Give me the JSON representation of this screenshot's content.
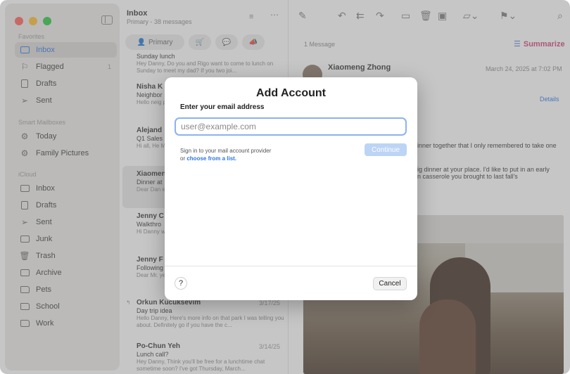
{
  "sidebar": {
    "favorites_header": "Favorites",
    "smart_header": "Smart Mailboxes",
    "icloud_header": "iCloud",
    "favorites": [
      {
        "label": "Inbox",
        "icon": "tray-icon"
      },
      {
        "label": "Flagged",
        "icon": "flag-icon",
        "count": "1"
      },
      {
        "label": "Drafts",
        "icon": "document-icon"
      },
      {
        "label": "Sent",
        "icon": "paperplane-icon"
      }
    ],
    "smart": [
      {
        "label": "Today",
        "icon": "gear-icon"
      },
      {
        "label": "Family Pictures",
        "icon": "gear-icon"
      }
    ],
    "icloud": [
      {
        "label": "Inbox",
        "icon": "tray-icon"
      },
      {
        "label": "Drafts",
        "icon": "document-icon"
      },
      {
        "label": "Sent",
        "icon": "paperplane-icon"
      },
      {
        "label": "Junk",
        "icon": "junk-icon"
      },
      {
        "label": "Trash",
        "icon": "trash-icon"
      },
      {
        "label": "Archive",
        "icon": "archive-icon"
      },
      {
        "label": "Pets",
        "icon": "folder-icon"
      },
      {
        "label": "School",
        "icon": "folder-icon"
      },
      {
        "label": "Work",
        "icon": "folder-icon"
      }
    ]
  },
  "message_list": {
    "title": "Inbox",
    "subtitle": "Primary - 38 messages",
    "primary_tab": "Primary",
    "messages": [
      {
        "from": "",
        "date": "",
        "subject": "Sunday lunch",
        "preview": "Hey Danny, Do you and Rigo want to come to lunch on Sunday to meet my dad? If you two joi..."
      },
      {
        "from": "Nisha K",
        "date": "",
        "subject": "Neighbor",
        "preview": "Hello neig planning"
      },
      {
        "from": "Alejand",
        "date": "",
        "subject": "Q1 Sales",
        "preview": "Hi all, He Mark IV a"
      },
      {
        "from": "Xiaomen",
        "date": "",
        "subject": "Dinner at",
        "preview": "Dear Dan evening."
      },
      {
        "from": "Jenny C",
        "date": "",
        "subject": "Walkthro",
        "preview": "Hi Danny walkthro"
      },
      {
        "from": "Jenny F",
        "date": "",
        "subject": "Following",
        "preview": "Dear Mr. yesterday"
      },
      {
        "from": "Orkun Kucuksevim",
        "date": "3/17/25",
        "subject": "Day trip idea",
        "preview": "Hello Danny, Here's more info on that park I was telling you about. Definitely go if you have the c..."
      },
      {
        "from": "Po-Chun Yeh",
        "date": "3/14/25",
        "subject": "Lunch call?",
        "preview": "Hey Danny, Think you'll be free for a lunchtime chat sometime soon? I've got Thursday, March..."
      }
    ]
  },
  "reader": {
    "message_count": "1 Message",
    "summarize_label": "Summarize",
    "sender": "Xiaomeng Zhong",
    "date": "March 24, 2025 at 7:02 PM",
    "details_label": "Details",
    "body_line1": "inner together that I only remembered to take one",
    "body_line2": "ig dinner at your place. I'd like to put in an early",
    "body_line3": "n casserole you brought to last fall's"
  },
  "modal": {
    "title": "Add Account",
    "email_label": "Enter your email address",
    "email_placeholder": "user@example.com",
    "email_value": "",
    "help_text": "Sign in to your mail account provider",
    "help_or": "or ",
    "help_link": "choose from a list.",
    "continue_label": "Continue",
    "help_button": "?",
    "cancel_label": "Cancel"
  },
  "colors": {
    "accent": "#2b77e6",
    "summarize": "#d1407a",
    "continue_disabled": "#bcd4f5"
  }
}
